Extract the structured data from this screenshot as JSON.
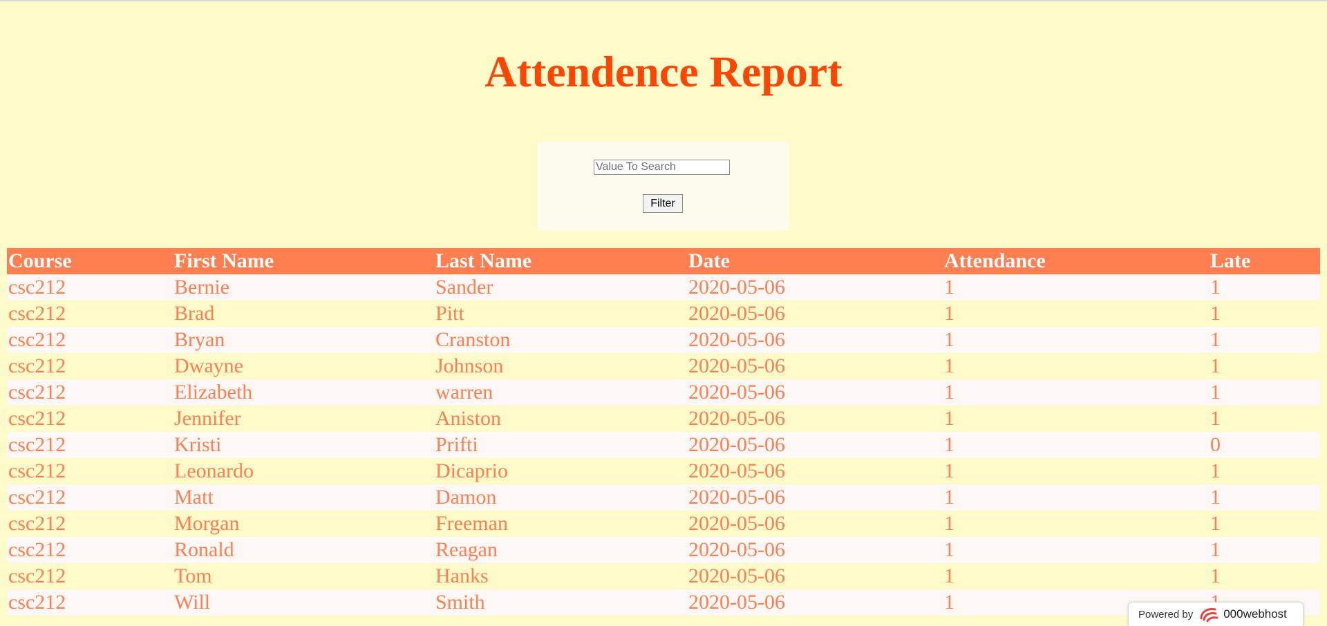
{
  "page": {
    "title": "Attendence Report"
  },
  "search": {
    "placeholder": "Value To Search",
    "value": "",
    "filter_label": "Filter"
  },
  "table": {
    "headers": [
      "Course",
      "First Name",
      "Last Name",
      "Date",
      "Attendance",
      "Late"
    ],
    "rows": [
      [
        "csc212",
        "Bernie",
        "Sander",
        "2020-05-06",
        "1",
        "1"
      ],
      [
        "csc212",
        "Brad",
        "Pitt",
        "2020-05-06",
        "1",
        "1"
      ],
      [
        "csc212",
        "Bryan",
        "Cranston",
        "2020-05-06",
        "1",
        "1"
      ],
      [
        "csc212",
        "Dwayne",
        "Johnson",
        "2020-05-06",
        "1",
        "1"
      ],
      [
        "csc212",
        "Elizabeth",
        "warren",
        "2020-05-06",
        "1",
        "1"
      ],
      [
        "csc212",
        "Jennifer",
        "Aniston",
        "2020-05-06",
        "1",
        "1"
      ],
      [
        "csc212",
        "Kristi",
        "Prifti",
        "2020-05-06",
        "1",
        "0"
      ],
      [
        "csc212",
        "Leonardo",
        "Dicaprio",
        "2020-05-06",
        "1",
        "1"
      ],
      [
        "csc212",
        "Matt",
        "Damon",
        "2020-05-06",
        "1",
        "1"
      ],
      [
        "csc212",
        "Morgan",
        "Freeman",
        "2020-05-06",
        "1",
        "1"
      ],
      [
        "csc212",
        "Ronald",
        "Reagan",
        "2020-05-06",
        "1",
        "1"
      ],
      [
        "csc212",
        "Tom",
        "Hanks",
        "2020-05-06",
        "1",
        "1"
      ],
      [
        "csc212",
        "Will",
        "Smith",
        "2020-05-06",
        "1",
        "1"
      ]
    ]
  },
  "badge": {
    "powered_label": "Powered by",
    "brand_label": "000webhost",
    "icon": "000webhost-logo-icon"
  },
  "colors": {
    "background": "#fefaca",
    "title": "#ff4500",
    "header_bg": "#ff7f50",
    "header_text": "#ffffff",
    "cell_text": "#ff7f50",
    "row_alt_bg": "#fdf8f5"
  }
}
